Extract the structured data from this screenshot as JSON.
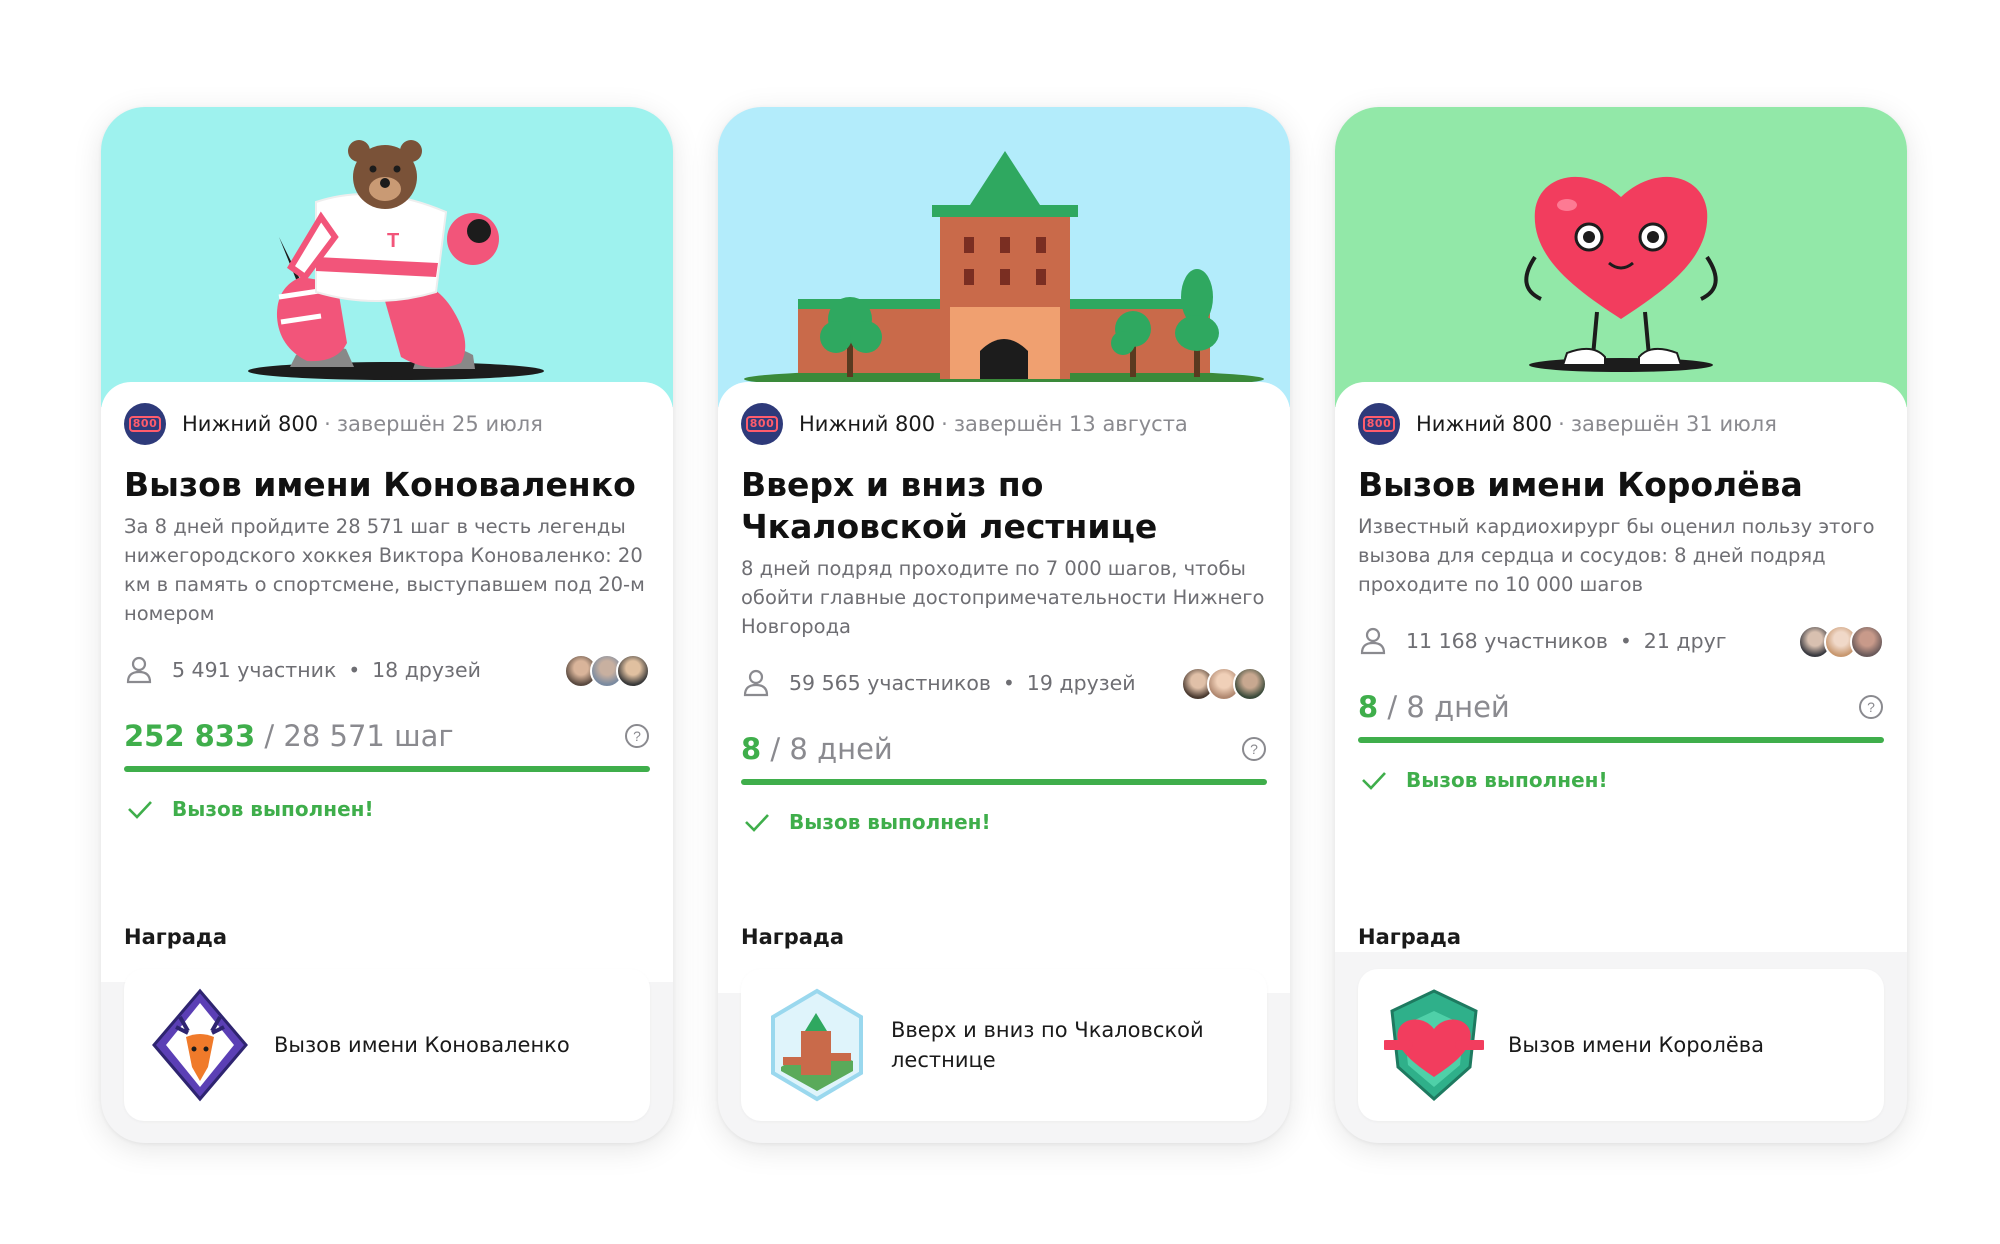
{
  "cards": [
    {
      "banner_color": "#9ef2ee",
      "organizer": "Нижний 800",
      "organizer_logo": "800",
      "finished": "завершён 25 июля",
      "title": "Вызов имени Коноваленко",
      "description": "За 8 дней пройдите 28 571 шаг в честь легенды нижегородского хоккея Виктора Коноваленко: 20 км в память о спортсмене, выступавшем под 20-м номером",
      "participants": "5 491 участник",
      "friends": "18 друзей",
      "progress_done": "252 833",
      "progress_total": " / 28 571 шаг",
      "progress_fraction": 1.0,
      "status": "Вызов выполнен!",
      "reward_label": "Награда",
      "reward_name": "Вызов имени Коноваленко",
      "illustration": "hockey-bear",
      "badge": "deer-badge"
    },
    {
      "banner_color": "#b3ecfb",
      "organizer": "Нижний 800",
      "organizer_logo": "800",
      "finished": "завершён 13 августа",
      "title": "Вверх и вниз по Чкаловской лестнице",
      "description": "8 дней подряд проходите по 7 000 шагов, чтобы обойти главные достопримечательности Нижнего Новгорода",
      "participants": "59 565 участников",
      "friends": "19 друзей",
      "progress_done": "8",
      "progress_total": " / 8 дней",
      "progress_fraction": 1.0,
      "status": "Вызов выполнен!",
      "reward_label": "Награда",
      "reward_name": "Вверх и вниз по Чкаловской лестнице",
      "illustration": "kremlin-tower",
      "badge": "kremlin-badge"
    },
    {
      "banner_color": "#92e8a8",
      "organizer": "Нижний 800",
      "organizer_logo": "800",
      "finished": "завершён 31 июля",
      "title": "Вызов имени Королёва",
      "description": "Известный кардиохирург бы оценил пользу этого вызова для сердца и сосудов: 8 дней подряд проходите по 10 000 шагов",
      "participants": "11 168 участников",
      "friends": "21 друг",
      "progress_done": "8",
      "progress_total": " / 8 дней",
      "progress_fraction": 1.0,
      "status": "Вызов выполнен!",
      "reward_label": "Награда",
      "reward_name": "Вызов имени Королёва",
      "illustration": "walking-heart",
      "badge": "heart-badge"
    }
  ]
}
